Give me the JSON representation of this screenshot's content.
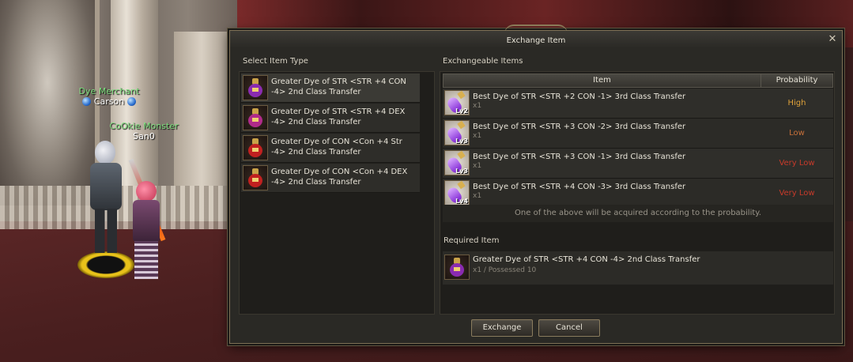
{
  "scene": {
    "npc": {
      "title": "Dye Merchant",
      "name": "Carson"
    },
    "player": {
      "title": "CoOkie Monster",
      "name": "San0"
    }
  },
  "dialog": {
    "title": "Exchange Item",
    "close_label": "✕",
    "left_header": "Select Item Type",
    "right_header": "Exchangeable Items",
    "item_types": [
      {
        "label": "Greater Dye of STR <STR +4 CON -4> 2nd Class Transfer",
        "bulb_color": "#8a2bb0"
      },
      {
        "label": "Greater Dye of STR <STR +4 DEX -4> 2nd Class Transfer",
        "bulb_color": "#b02a8a"
      },
      {
        "label": "Greater Dye of CON <Con +4 Str -4> 2nd Class Transfer",
        "bulb_color": "#c02020"
      },
      {
        "label": "Greater Dye of CON <Con +4 DEX -4> 2nd Class Transfer",
        "bulb_color": "#c02020"
      }
    ],
    "table": {
      "col_item": "Item",
      "col_probability": "Probability",
      "rows": [
        {
          "name": "Best Dye of STR <STR +2 CON -1> 3rd Class Transfer",
          "qty": "x1",
          "level": "Lv2",
          "probability": "High",
          "prob_color": "#e0a23a"
        },
        {
          "name": "Best Dye of STR <STR +3 CON -2> 3rd Class Transfer",
          "qty": "x1",
          "level": "Lv3",
          "probability": "Low",
          "prob_color": "#c8703a"
        },
        {
          "name": "Best Dye of STR <STR +3 CON -1> 3rd Class Transfer",
          "qty": "x1",
          "level": "Lv3",
          "probability": "Very Low",
          "prob_color": "#c83a2a"
        },
        {
          "name": "Best Dye of STR <STR +4 CON -3> 3rd Class Transfer",
          "qty": "x1",
          "level": "Lv4",
          "probability": "Very Low",
          "prob_color": "#c83a2a"
        }
      ],
      "note": "One of the above will be acquired according to the probability."
    },
    "required_header": "Required Item",
    "required_item": {
      "name": "Greater Dye of STR <STR +4 CON -4> 2nd Class Transfer",
      "qty": "x1 / Possessed 10"
    },
    "buttons": {
      "exchange": "Exchange",
      "cancel": "Cancel"
    }
  }
}
